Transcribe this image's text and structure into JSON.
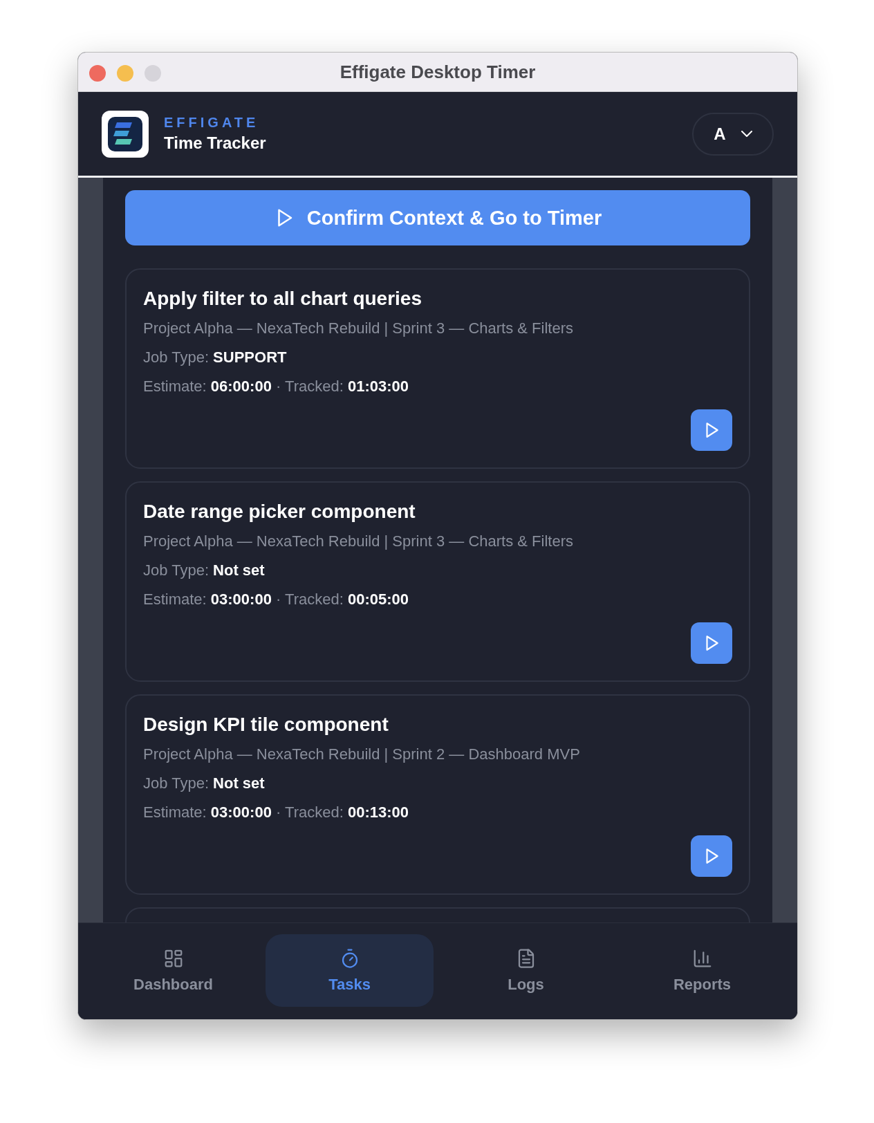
{
  "window": {
    "title": "Effigate Desktop Timer"
  },
  "header": {
    "brand": "EFFIGATE",
    "subtitle": "Time Tracker",
    "user_initial": "A"
  },
  "primary_button": {
    "label": "Confirm Context & Go to Timer"
  },
  "tasks": [
    {
      "title": "Apply filter to all chart queries",
      "context": "Project Alpha — NexaTech Rebuild | Sprint 3 — Charts & Filters",
      "job_type": "Job Type: **SUPPORT**",
      "times": "Estimate: **06:00:00** · Tracked: **01:03:00**"
    },
    {
      "title": "Date range picker component",
      "context": "Project Alpha — NexaTech Rebuild | Sprint 3 — Charts & Filters",
      "job_type": "Job Type: **Not set**",
      "times": "Estimate: **03:00:00** · Tracked: **00:05:00**"
    },
    {
      "title": "Design KPI tile component",
      "context": "Project Alpha — NexaTech Rebuild | Sprint 2 — Dashboard MVP",
      "job_type": "Job Type: **Not set**",
      "times": "Estimate: **03:00:00** · Tracked: **00:13:00**"
    }
  ],
  "more_tasks_below": true,
  "nav": [
    {
      "label": "Dashboard",
      "kind": "dashboard",
      "selected": false
    },
    {
      "label": "Tasks",
      "kind": "timer",
      "selected": true
    },
    {
      "label": "Logs",
      "kind": "logs",
      "selected": false
    },
    {
      "label": "Reports",
      "kind": "reports",
      "selected": false
    }
  ]
}
